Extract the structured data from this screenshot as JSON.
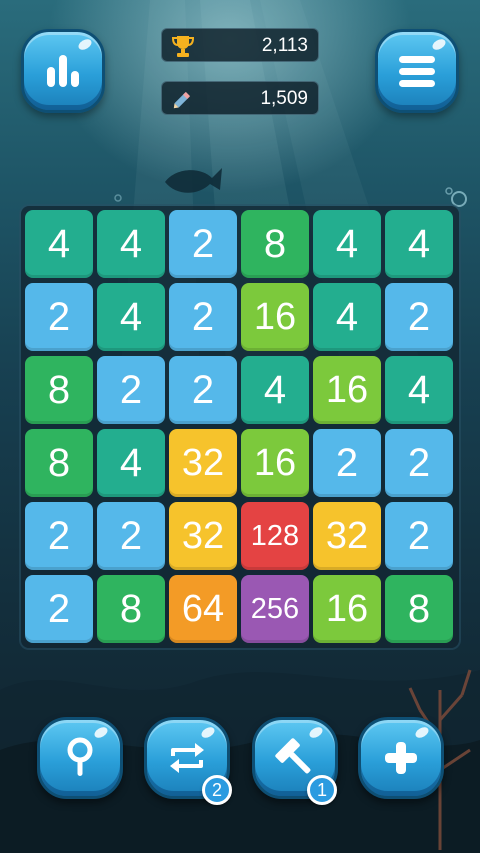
{
  "scores": {
    "best": "2,113",
    "best_icon": "trophy-icon",
    "current": "1,509",
    "current_icon": "pencil-icon"
  },
  "buttons": {
    "stats_icon": "bar-chart-icon",
    "menu_icon": "hamburger-menu-icon",
    "search_icon": "magnifier-icon",
    "swap_icon": "swap-arrows-icon",
    "swap_count": "2",
    "hammer_icon": "hammer-icon",
    "hammer_count": "1",
    "add_icon": "plus-icon"
  },
  "board": {
    "columns": 6,
    "rows": [
      [
        "4",
        "4",
        "2",
        "8",
        "4",
        "4"
      ],
      [
        "2",
        "4",
        "2",
        "16",
        "4",
        "2"
      ],
      [
        "8",
        "2",
        "2",
        "4",
        "16",
        "4"
      ],
      [
        "8",
        "4",
        "32",
        "16",
        "2",
        "2"
      ],
      [
        "2",
        "2",
        "32",
        "128",
        "32",
        "2"
      ],
      [
        "2",
        "8",
        "64",
        "256",
        "16",
        "8"
      ]
    ]
  },
  "tile_colors": {
    "2": "#55b8ea",
    "4": "#23ae8f",
    "8": "#2fb45f",
    "16": "#7cc93c",
    "32": "#f6c32c",
    "64": "#f39b26",
    "128": "#e44343",
    "256": "#9a58b3"
  }
}
